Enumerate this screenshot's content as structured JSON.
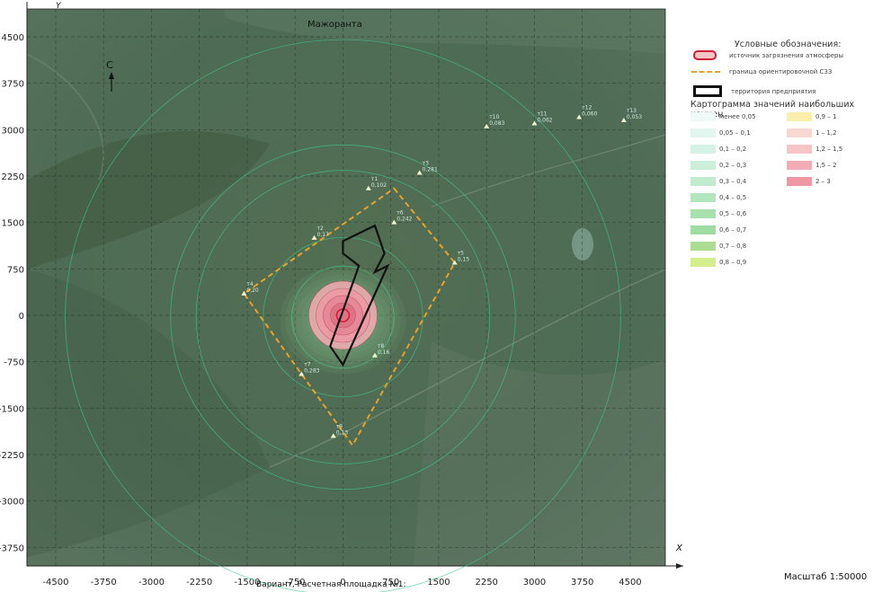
{
  "map": {
    "top_label": "Мажоранта",
    "x_axis_name": "X",
    "y_axis_name": "Y",
    "north_label": "С",
    "x_ticks": [
      "-4500",
      "-3750",
      "-3000",
      "-2250",
      "-1500",
      "-750",
      "0",
      "750",
      "1500",
      "2250",
      "3000",
      "3750",
      "4500"
    ],
    "y_ticks": [
      "4500",
      "3750",
      "3000",
      "2250",
      "1500",
      "750",
      "0",
      "-750",
      "-1500",
      "-2250",
      "-3000",
      "-3750"
    ],
    "x_range": [
      -4950,
      5050
    ],
    "y_range": [
      -4050,
      4950
    ],
    "points": [
      {
        "id": "т1",
        "value": "0,102",
        "x": 400,
        "y": 2050
      },
      {
        "id": "т3",
        "value": "0,281",
        "x": 1200,
        "y": 2300
      },
      {
        "id": "т6",
        "value": "0,242",
        "x": 800,
        "y": 1500
      },
      {
        "id": "т5",
        "value": "0,15",
        "x": 1750,
        "y": 850
      },
      {
        "id": "т2",
        "value": "0,17",
        "x": -450,
        "y": 1250
      },
      {
        "id": "т4",
        "value": "0,20",
        "x": -1550,
        "y": 350
      },
      {
        "id": "т7",
        "value": "0,283",
        "x": -650,
        "y": -950
      },
      {
        "id": "т8",
        "value": "0,16",
        "x": 500,
        "y": -650
      },
      {
        "id": "т9",
        "value": "0,13",
        "x": -150,
        "y": -1950
      },
      {
        "id": "т10",
        "value": "0,083",
        "x": 2250,
        "y": 3050
      },
      {
        "id": "т11",
        "value": "0,062",
        "x": 3000,
        "y": 3100
      },
      {
        "id": "т12",
        "value": "0,060",
        "x": 3700,
        "y": 3200
      },
      {
        "id": "т13",
        "value": "0,053",
        "x": 4400,
        "y": 3150
      }
    ],
    "sanitary_zone": [
      [
        800,
        2050
      ],
      [
        1750,
        850
      ],
      [
        150,
        -2100
      ],
      [
        -1550,
        350
      ]
    ],
    "enterprise": [
      [
        0,
        1200
      ],
      [
        500,
        1450
      ],
      [
        650,
        1000
      ],
      [
        500,
        700
      ],
      [
        700,
        800
      ],
      [
        0,
        -800
      ],
      [
        -200,
        -500
      ],
      [
        250,
        800
      ],
      [
        0,
        1000
      ]
    ]
  },
  "legend": {
    "title": "Условные обозначения:",
    "source_label": "источник загрязнения атмосферы",
    "szz_label": "граница ориентировочной СЗЗ",
    "territory_label": "территория предприятия",
    "carto_title": "Картограмма значений наибольших концен",
    "ranges": [
      {
        "label": "менее 0,05",
        "color": "#eefaf7"
      },
      {
        "label": "0,05 – 0,1",
        "color": "#e2f6f0"
      },
      {
        "label": "0,1 – 0,2",
        "color": "#d5f2e6"
      },
      {
        "label": "0,2 – 0,3",
        "color": "#cbefd9"
      },
      {
        "label": "0,3 – 0,4",
        "color": "#c0ebcc"
      },
      {
        "label": "0,4 – 0,5",
        "color": "#b4e6bd"
      },
      {
        "label": "0,5 – 0,6",
        "color": "#a8e1ae"
      },
      {
        "label": "0,6 – 0,7",
        "color": "#9edca1"
      },
      {
        "label": "0,7 – 0,8",
        "color": "#a9de93"
      },
      {
        "label": "0,8 – 0,9",
        "color": "#d5ee8d"
      },
      {
        "label": "0,9 – 1",
        "color": "#fbeeaa"
      },
      {
        "label": "1 – 1,2",
        "color": "#f9d8d2"
      },
      {
        "label": "1,2 – 1,5",
        "color": "#f7c4c6"
      },
      {
        "label": "1,5 – 2",
        "color": "#f3acb3"
      },
      {
        "label": "2 – 3",
        "color": "#ef98a3"
      }
    ]
  },
  "scale_label": "Масштаб 1:50000",
  "footer_label": "Вариант, Расчетная площадка №1:",
  "colors": {
    "szz": "#e8a22a",
    "enterprise": "#111111",
    "point": "#f2f7cc",
    "contour": "#3ac98f",
    "source": "#d02035"
  }
}
